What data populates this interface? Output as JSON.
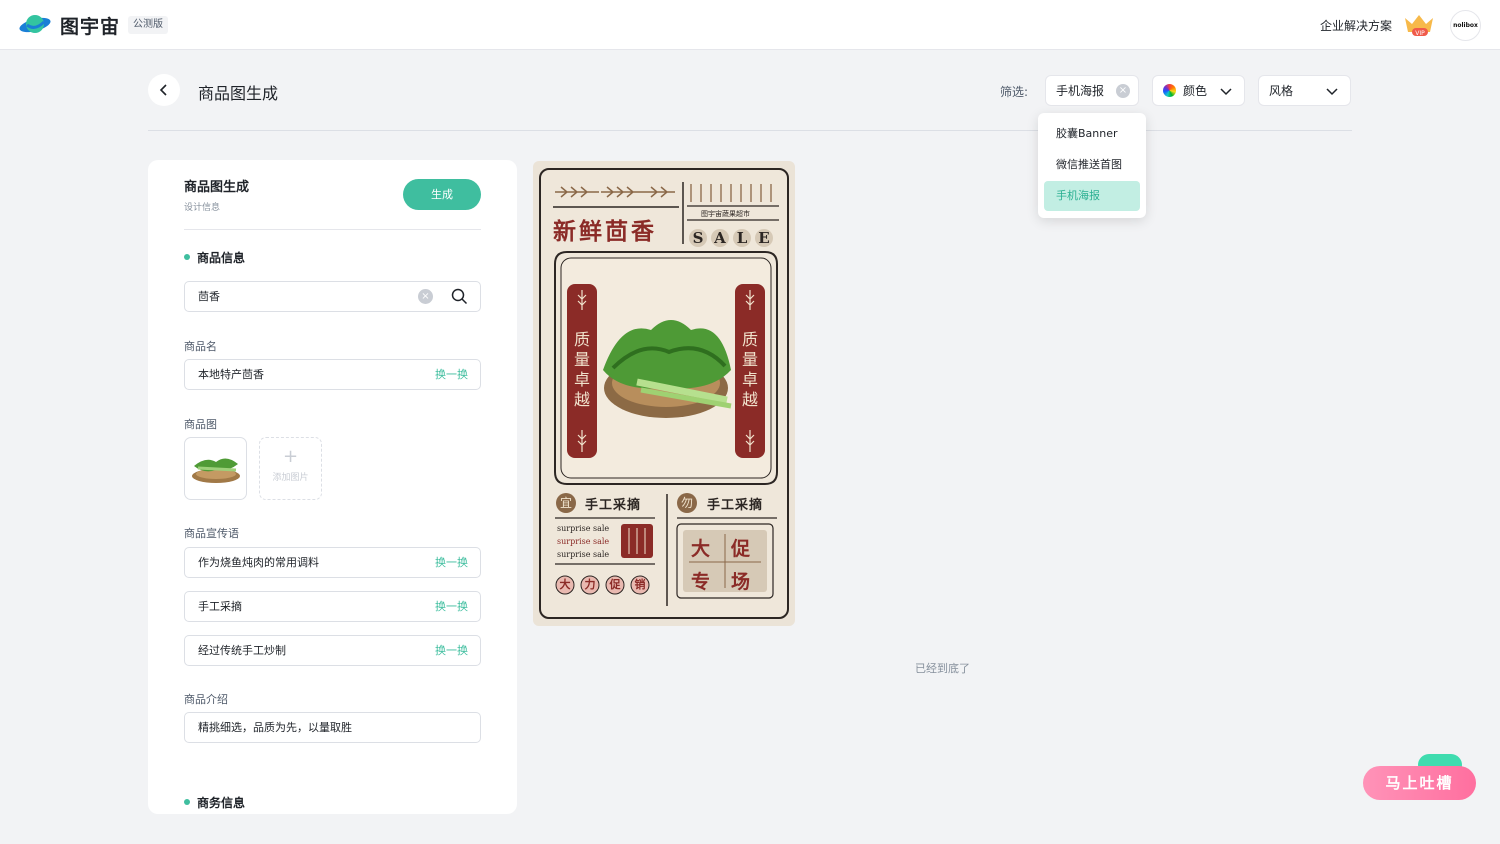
{
  "topbar": {
    "brand": "图宇宙",
    "badge": "公测版",
    "enterprise_link": "企业解决方案",
    "vip_label": "VIP",
    "avatar_text": "nolibox"
  },
  "header": {
    "title": "商品图生成",
    "filter_label": "筛选:",
    "filter_type_value": "手机海报",
    "filter_color_label": "颜色",
    "filter_style_label": "风格"
  },
  "dropdown": {
    "items": [
      "胶囊Banner",
      "微信推送首图",
      "手机海报"
    ],
    "selected": "手机海报"
  },
  "panel": {
    "title": "商品图生成",
    "subtitle": "设计信息",
    "generate_button": "生成",
    "section_product": "商品信息",
    "search_value": "茴香",
    "name_label": "商品名",
    "name_value": "本地特产茴香",
    "swap_label": "换一换",
    "image_label": "商品图",
    "add_image": "添加图片",
    "slogan_label": "商品宣传语",
    "slogans": [
      "作为烧鱼炖肉的常用调料",
      "手工采摘",
      "经过传统手工炒制"
    ],
    "intro_label": "商品介绍",
    "intro_value": "精挑细选，品质为先，以量取胜",
    "section_business": "商务信息"
  },
  "poster": {
    "headline": "新鲜茴香",
    "store": "图宇宙蔬果超市",
    "sale": [
      "S",
      "A",
      "L",
      "E"
    ],
    "side_text": [
      "质",
      "量",
      "卓",
      "越"
    ],
    "left_badge": "宜",
    "left_caption": "手工采摘",
    "right_badge": "勿",
    "right_caption": "手工采摘",
    "surprise": [
      "surprise sale",
      "surprise sale",
      "surprise sale"
    ],
    "promo_circles": [
      "大",
      "力",
      "促",
      "销"
    ],
    "promo_box": [
      "大",
      "促",
      "专",
      "场"
    ]
  },
  "footer_note": "已经到底了",
  "feedback_button": "马上吐槽",
  "colors": {
    "accent": "#3fbe9f",
    "poster_red": "#8b2b27",
    "poster_bg": "#efe7da"
  }
}
